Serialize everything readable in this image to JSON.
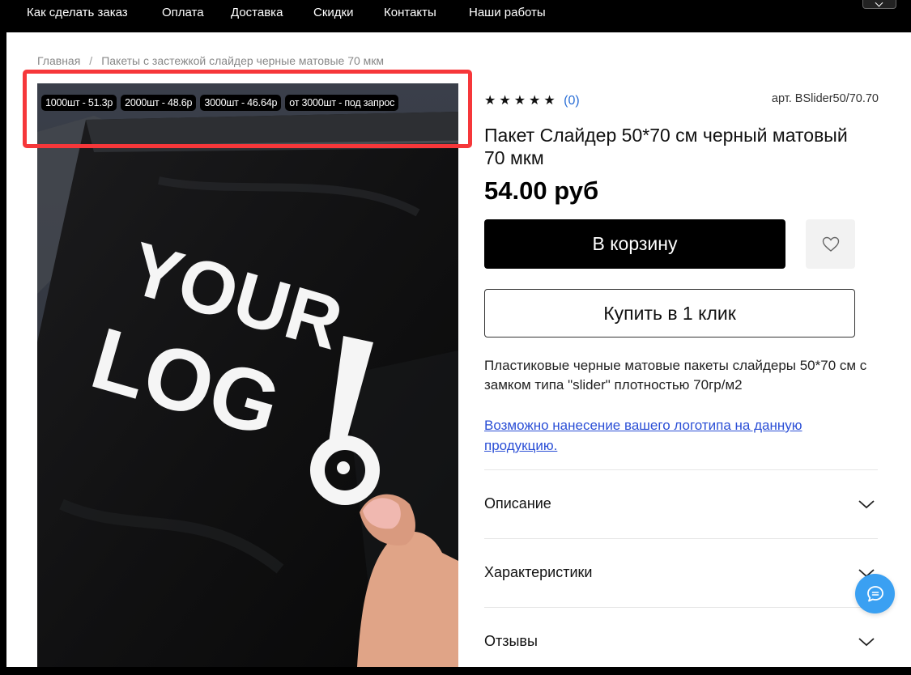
{
  "nav": {
    "items": [
      "Как сделать заказ",
      "Оплата",
      "Доставка",
      "Скидки",
      "Контакты",
      "Наши работы"
    ]
  },
  "breadcrumb": {
    "home": "Главная",
    "separator": "/",
    "current": "Пакеты с застежкой слайдер черные матовые 70 мкм"
  },
  "photo": {
    "price_tags": [
      "1000шт - 51.3р",
      "2000шт - 48.6р",
      "3000шт - 46.64р",
      "от 3000шт - под запрос"
    ],
    "logo_line1": "YOUR",
    "logo_line2": "LOG",
    "highlight_color": "#f6373a"
  },
  "product": {
    "stars": "★★★★★",
    "reviews_count": "(0)",
    "sku": "арт. BSlider50/70.70",
    "title": "Пакет Слайдер 50*70 см черный матовый 70 мкм",
    "price": "54.00 руб",
    "add_to_cart": "В корзину",
    "buy_one_click": "Купить в 1 клик",
    "description": "Пластиковые черные матовые пакеты слайдеры 50*70 см с замком типа \"slider\" плотностью 70гр/м2",
    "logo_link": "Возможно нанесение вашего логотипа на данную продукцию."
  },
  "accordion": [
    "Описание",
    "Характеристики",
    "Отзывы"
  ],
  "colors": {
    "nav_bg": "#000000",
    "accent_link": "#2b4fd6",
    "chat_button": "#3aa0f2"
  },
  "icons": {
    "favorite": "heart-icon",
    "accordion": "chevron-down-icon",
    "chat": "chat-bubble-icon",
    "menu": "chevron-down-icon"
  }
}
